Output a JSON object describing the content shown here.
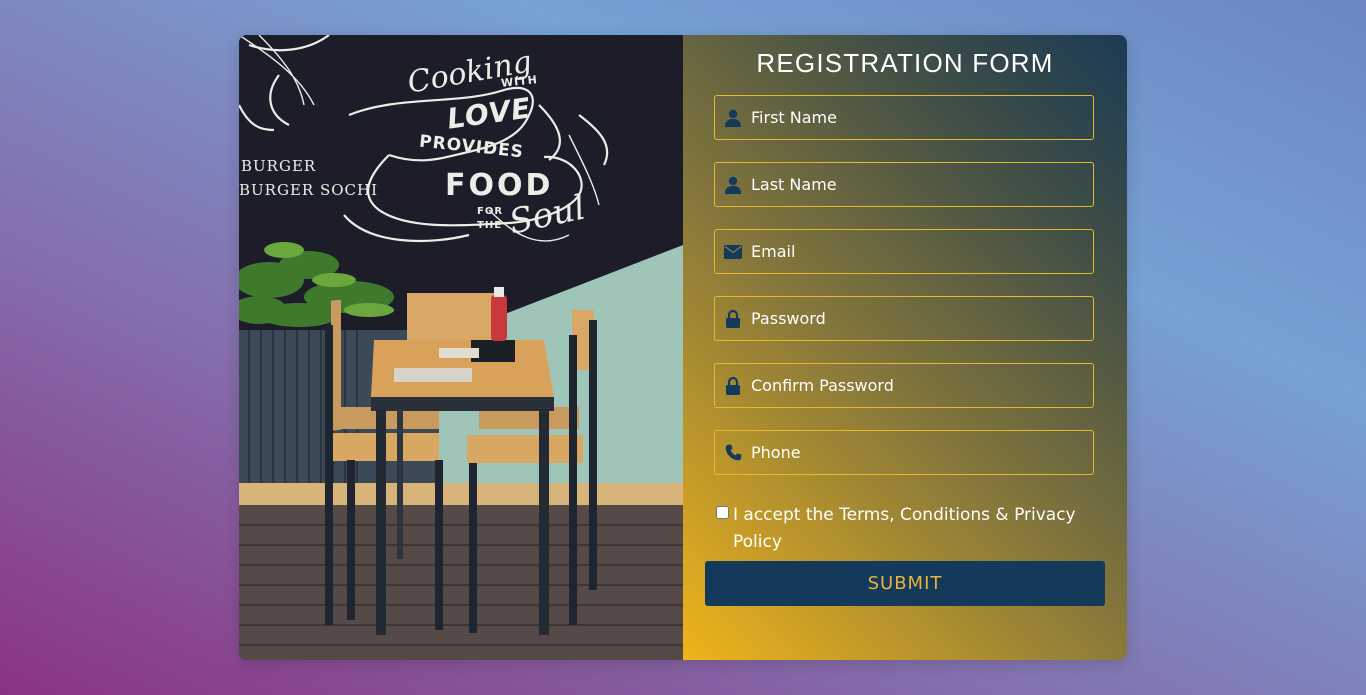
{
  "form": {
    "title": "REGISTRATION FORM",
    "fields": [
      {
        "placeholder": "First Name",
        "icon": "user-icon"
      },
      {
        "placeholder": "Last Name",
        "icon": "user-icon"
      },
      {
        "placeholder": "Email",
        "icon": "envelope-icon"
      },
      {
        "placeholder": "Password",
        "icon": "lock-icon"
      },
      {
        "placeholder": "Confirm Password",
        "icon": "lock-icon"
      },
      {
        "placeholder": "Phone",
        "icon": "phone-icon"
      }
    ],
    "terms_label": "I accept the Terms, Conditions & Privacy Policy",
    "submit_label": "SUBMIT"
  },
  "photo": {
    "chalk": {
      "cooking": "Cooking",
      "with": "WITH",
      "love": "LOVE",
      "provides": "PROVIDES",
      "food": "FOOD",
      "for": "FOR",
      "the": "THE",
      "soul": "Soul",
      "burger_line1": "BURGER",
      "burger_line2": "BURGER SOCHI"
    }
  },
  "colors": {
    "accent": "#e6b92c",
    "button_bg": "#14395a",
    "button_text": "#e7b43a",
    "icon": "#14395a"
  }
}
